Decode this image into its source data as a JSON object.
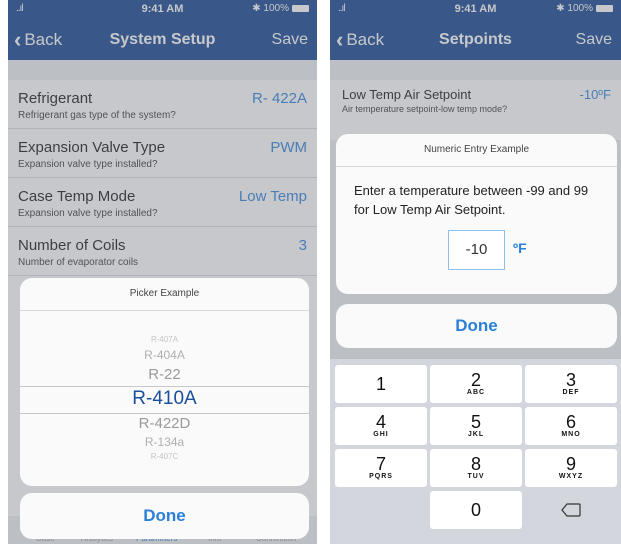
{
  "status": {
    "time": "9:41 AM",
    "battery": "100%",
    "signal": "..ıl"
  },
  "left": {
    "nav": {
      "back": "Back",
      "title": "System Setup",
      "save": "Save"
    },
    "rows": [
      {
        "label": "Refrigerant",
        "sub": "Refrigerant gas type of the system?",
        "value": "R- 422A"
      },
      {
        "label": "Expansion Valve Type",
        "sub": "Expansion valve type installed?",
        "value": "PWM"
      },
      {
        "label": "Case Temp Mode",
        "sub": "Expansion valve type installed?",
        "value": "Low Temp"
      },
      {
        "label": "Number of Coils",
        "sub": "Number of evaporator coils",
        "value": "3"
      }
    ],
    "picker": {
      "title": "Picker Example",
      "options": [
        "R-407A",
        "R-404A",
        "R-22",
        "R-410A",
        "R-422D",
        "R-134a",
        "R-407C"
      ],
      "selected": "R-410A",
      "done": "Done"
    },
    "tabs": [
      "Case",
      "Analytics",
      "Parameters",
      "Info",
      "Connection"
    ]
  },
  "right": {
    "nav": {
      "back": "Back",
      "title": "Setpoints",
      "save": "Save"
    },
    "setting": {
      "label": "Low Temp Air Setpoint",
      "sub": "Air temperature setpoint-low temp mode?",
      "value": "-10ºF"
    },
    "alert": {
      "title": "Numeric Entry Example",
      "message": "Enter a temperature between -99 and 99 for Low Temp Air Setpoint.",
      "input_value": "-10",
      "unit": "ºF",
      "done": "Done"
    },
    "keypad": [
      {
        "num": "1",
        "letters": ""
      },
      {
        "num": "2",
        "letters": "ABC"
      },
      {
        "num": "3",
        "letters": "DEF"
      },
      {
        "num": "4",
        "letters": "GHI"
      },
      {
        "num": "5",
        "letters": "JKL"
      },
      {
        "num": "6",
        "letters": "MNO"
      },
      {
        "num": "7",
        "letters": "PQRS"
      },
      {
        "num": "8",
        "letters": "TUV"
      },
      {
        "num": "9",
        "letters": "WXYZ"
      },
      {
        "num": "0",
        "letters": ""
      }
    ]
  },
  "colors": {
    "nav_bar": "#0d3d8c",
    "accent": "#2a7fd9",
    "picker_selected": "#1a4f9c"
  }
}
